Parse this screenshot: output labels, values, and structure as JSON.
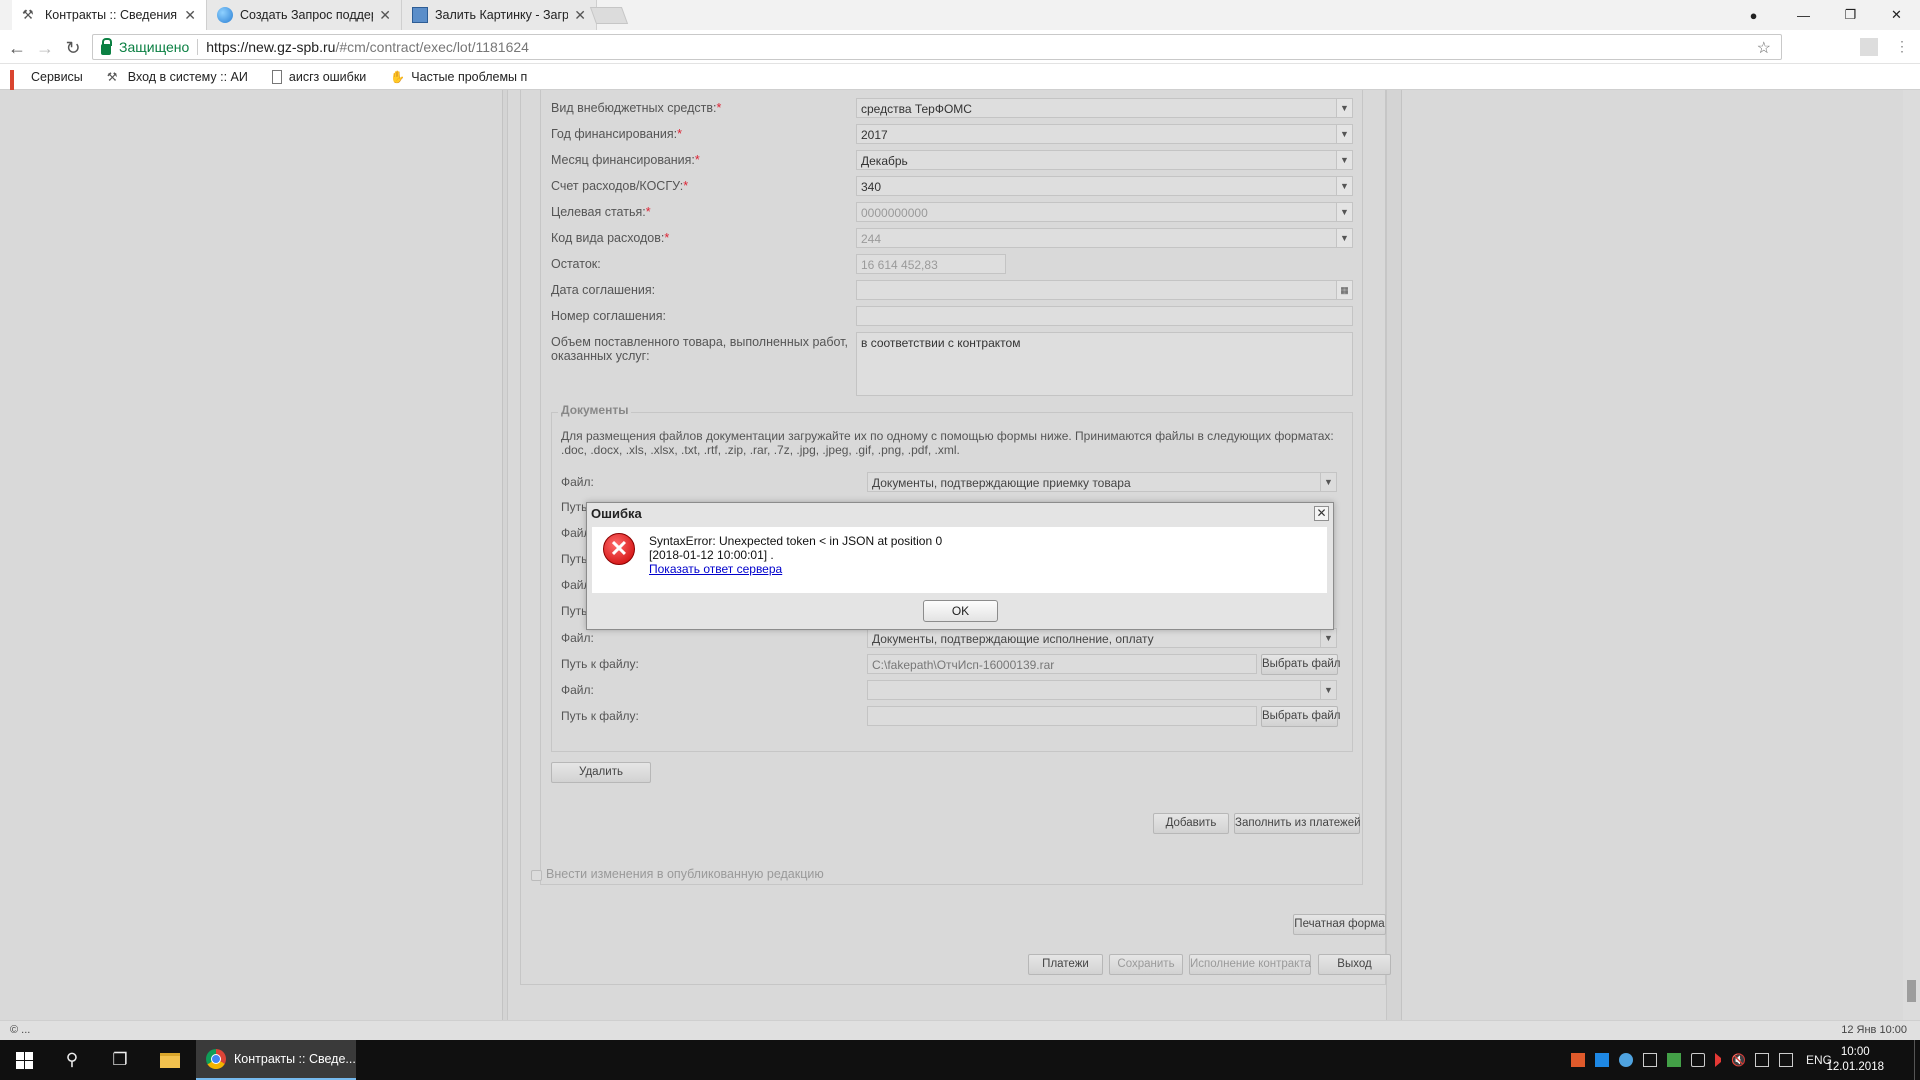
{
  "browser": {
    "tabs": [
      {
        "title": "Контракты :: Сведения о",
        "active": true
      },
      {
        "title": "Создать Запрос поддер",
        "active": false
      },
      {
        "title": "Залить Картинку - Загру",
        "active": false
      }
    ],
    "security_label": "Защищено",
    "url_host": "https://new.gz-spb.ru",
    "url_path": "/#cm/contract/exec/lot/1181624",
    "bookmarks": [
      "Сервисы",
      "Вход в систему :: АИ",
      "аисгз ошибки",
      "Частые проблемы п"
    ]
  },
  "form": {
    "fields": [
      {
        "label": "Вид внебюджетных средств:",
        "required": true,
        "value": "средства ТерФОМС",
        "dropdown": true,
        "disabled": false
      },
      {
        "label": "Год финансирования:",
        "required": true,
        "value": "2017",
        "dropdown": true,
        "disabled": false
      },
      {
        "label": "Месяц финансирования:",
        "required": true,
        "value": "Декабрь",
        "dropdown": true,
        "disabled": false
      },
      {
        "label": "Счет расходов/КОСГУ:",
        "required": true,
        "value": "340",
        "dropdown": true,
        "disabled": false
      },
      {
        "label": "Целевая статья:",
        "required": true,
        "value": "0000000000",
        "dropdown": true,
        "disabled": true
      },
      {
        "label": "Код вида расходов:",
        "required": true,
        "value": "244",
        "dropdown": true,
        "disabled": true
      },
      {
        "label": "Остаток:",
        "required": false,
        "value": "16 614 452,83",
        "dropdown": false,
        "disabled": true
      },
      {
        "label": "Дата соглашения:",
        "required": false,
        "value": "",
        "dropdown": false,
        "disabled": true
      },
      {
        "label": "Номер соглашения:",
        "required": false,
        "value": "",
        "dropdown": false,
        "disabled": true
      }
    ],
    "volume_label": "Объем поставленного товара, выполненных работ, оказанных услуг:",
    "volume_value": "в соответствии с контрактом",
    "documents": {
      "legend": "Документы",
      "info": "Для размещения файлов документации загружайте их по одному с помощью формы ниже. Принимаются файлы в следующих форматах: .doc, .docx, .xls, .xlsx, .txt, .rtf, .zip, .rar, .7z, .jpg, .jpeg, .gif, .png, .pdf, .xml.",
      "file_label": "Файл:",
      "path_label": "Путь к файлу:",
      "path_label_short": "Путь",
      "first_file": "Документы, подтверждающие приемку товара",
      "file_exec": "Документы, подтверждающие исполнение, оплату",
      "file_path": "C:\\fakepath\\ОтчИсп-16000139.rar",
      "choose_file": "Выбрать файл"
    },
    "buttons": {
      "delete": "Удалить",
      "add": "Добавить",
      "fill_from_payments": "Заполнить из платежей",
      "publish_changes": "Внести изменения в опубликованную редакцию",
      "print_form": "Печатная форма",
      "payments": "Платежи",
      "save": "Сохранить",
      "contract_execution": "Исполнение контракта",
      "exit": "Выход"
    }
  },
  "dialog": {
    "title": "Ошибка",
    "line1": "SyntaxError: Unexpected token < in JSON at position 0",
    "line2": "[2018-01-12 10:00:01] .",
    "link": "Показать ответ сервера",
    "ok": "OK",
    "close_glyph": "✕",
    "icon_glyph": "✕"
  },
  "status": {
    "left": "© ...",
    "right": "12 Янв 10:00"
  },
  "taskbar": {
    "app_label": "Контракты :: Сведе...",
    "lang": "ENG",
    "time": "10:00",
    "date": "12.01.2018"
  }
}
